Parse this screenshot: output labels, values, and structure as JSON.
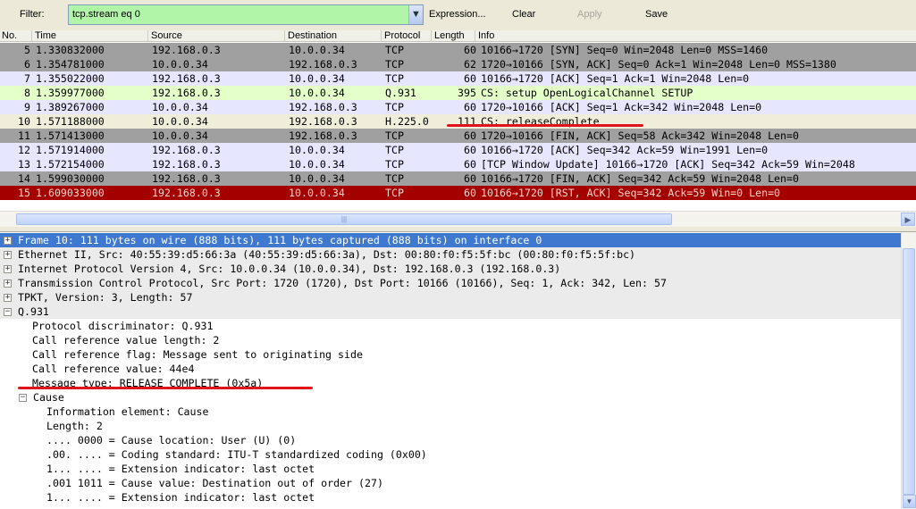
{
  "toolbar": {
    "filter_label": "Filter:",
    "filter_value": "tcp.stream eq 0",
    "expression_label": "Expression...",
    "clear_label": "Clear",
    "apply_label": "Apply",
    "save_label": "Save"
  },
  "packet_list": {
    "columns": [
      "No.",
      "Time",
      "Source",
      "Destination",
      "Protocol",
      "Length",
      "Info"
    ],
    "rows": [
      {
        "no": "5",
        "time": "1.330832000",
        "src": "192.168.0.3",
        "dst": "10.0.0.34",
        "proto": "TCP",
        "len": "60",
        "info": "10166→1720 [SYN] Seq=0 Win=2048 Len=0 MSS=1460",
        "bg": "#a0a0a0",
        "fg": "#000000"
      },
      {
        "no": "6",
        "time": "1.354781000",
        "src": "10.0.0.34",
        "dst": "192.168.0.3",
        "proto": "TCP",
        "len": "62",
        "info": "1720→10166 [SYN, ACK] Seq=0 Ack=1 Win=2048 Len=0 MSS=1380",
        "bg": "#a0a0a0",
        "fg": "#000000"
      },
      {
        "no": "7",
        "time": "1.355022000",
        "src": "192.168.0.3",
        "dst": "10.0.0.34",
        "proto": "TCP",
        "len": "60",
        "info": "10166→1720 [ACK] Seq=1 Ack=1 Win=2048 Len=0",
        "bg": "#e7e6ff",
        "fg": "#000000"
      },
      {
        "no": "8",
        "time": "1.359977000",
        "src": "192.168.0.3",
        "dst": "10.0.0.34",
        "proto": "Q.931",
        "len": "395",
        "info": "CS: setup OpenLogicalChannel SETUP",
        "bg": "#e4ffc7",
        "fg": "#000000"
      },
      {
        "no": "9",
        "time": "1.389267000",
        "src": "10.0.0.34",
        "dst": "192.168.0.3",
        "proto": "TCP",
        "len": "60",
        "info": "1720→10166 [ACK] Seq=1 Ack=342 Win=2048 Len=0",
        "bg": "#e7e6ff",
        "fg": "#000000"
      },
      {
        "no": "10",
        "time": "1.571188000",
        "src": "10.0.0.34",
        "dst": "192.168.0.3",
        "proto": "H.225.0",
        "len": "111",
        "info": "CS: releaseComplete",
        "bg": "#f0eedb",
        "fg": "#000000"
      },
      {
        "no": "11",
        "time": "1.571413000",
        "src": "10.0.0.34",
        "dst": "192.168.0.3",
        "proto": "TCP",
        "len": "60",
        "info": "1720→10166 [FIN, ACK] Seq=58 Ack=342 Win=2048 Len=0",
        "bg": "#a0a0a0",
        "fg": "#000000"
      },
      {
        "no": "12",
        "time": "1.571914000",
        "src": "192.168.0.3",
        "dst": "10.0.0.34",
        "proto": "TCP",
        "len": "60",
        "info": "10166→1720 [ACK] Seq=342 Ack=59 Win=1991 Len=0",
        "bg": "#e7e6ff",
        "fg": "#000000"
      },
      {
        "no": "13",
        "time": "1.572154000",
        "src": "192.168.0.3",
        "dst": "10.0.0.34",
        "proto": "TCP",
        "len": "60",
        "info": "[TCP Window Update] 10166→1720 [ACK] Seq=342 Ack=59 Win=2048",
        "bg": "#e7e6ff",
        "fg": "#000000"
      },
      {
        "no": "14",
        "time": "1.599030000",
        "src": "192.168.0.3",
        "dst": "10.0.0.34",
        "proto": "TCP",
        "len": "60",
        "info": "10166→1720 [FIN, ACK] Seq=342 Ack=59 Win=2048 Len=0",
        "bg": "#a0a0a0",
        "fg": "#000000"
      },
      {
        "no": "15",
        "time": "1.609033000",
        "src": "192.168.0.3",
        "dst": "10.0.0.34",
        "proto": "TCP",
        "len": "60",
        "info": "10166→1720 [RST, ACK] Seq=342 Ack=59 Win=0 Len=0",
        "bg": "#a40000",
        "fg": "#ffd7d0"
      }
    ]
  },
  "details": {
    "rows": [
      {
        "text": "Frame 10: 111 bytes on wire (888 bits), 111 bytes captured (888 bits) on interface 0",
        "exp": "+",
        "selected": true
      },
      {
        "text": "Ethernet II, Src: 40:55:39:d5:66:3a (40:55:39:d5:66:3a), Dst: 00:80:f0:f5:5f:bc (00:80:f0:f5:5f:bc)",
        "exp": "+"
      },
      {
        "text": "Internet Protocol Version 4, Src: 10.0.0.34 (10.0.0.34), Dst: 192.168.0.3 (192.168.0.3)",
        "exp": "+"
      },
      {
        "text": "Transmission Control Protocol, Src Port: 1720 (1720), Dst Port: 10166 (10166), Seq: 1, Ack: 342, Len: 57",
        "exp": "+"
      },
      {
        "text": "TPKT, Version: 3, Length: 57",
        "exp": "+"
      },
      {
        "text": "Q.931",
        "exp": "−"
      },
      {
        "text": "Protocol discriminator: Q.931"
      },
      {
        "text": "Call reference value length: 2"
      },
      {
        "text": "Call reference flag: Message sent to originating side"
      },
      {
        "text": "Call reference value: 44e4"
      },
      {
        "text": "Message type: RELEASE COMPLETE (0x5a)"
      },
      {
        "text": "Cause",
        "exp": "−"
      },
      {
        "text": "Information element: Cause"
      },
      {
        "text": "Length: 2"
      },
      {
        "text": ".... 0000 = Cause location: User (U) (0)"
      },
      {
        "text": ".00. .... = Coding standard: ITU-T standardized coding (0x00)"
      },
      {
        "text": "1... .... = Extension indicator: last octet"
      },
      {
        "text": ".001 1011 = Cause value: Destination out of order (27)"
      },
      {
        "text": "1... .... = Extension indicator: last octet"
      }
    ]
  },
  "colors": {
    "filter_bg": "#b0f5a8",
    "selection": "#3f78cf",
    "annotation_red": "#e0141c"
  }
}
